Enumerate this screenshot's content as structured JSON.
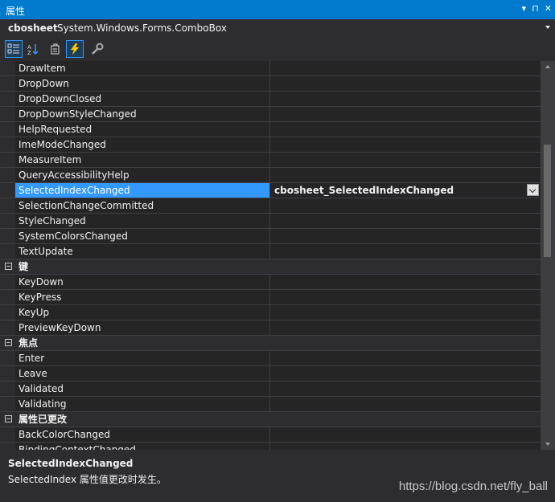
{
  "panel": {
    "title": "属性",
    "controls": [
      "▾",
      "⊓",
      "✕"
    ]
  },
  "object": {
    "name": "cbosheet",
    "type": "System.Windows.Forms.ComboBox"
  },
  "toolbar": {
    "buttons": [
      {
        "name": "categorized-icon",
        "active": true
      },
      {
        "name": "alphabetical-icon",
        "active": false
      },
      {
        "name": "properties-icon",
        "active": false
      },
      {
        "name": "events-icon",
        "active": true
      },
      {
        "name": "property-pages-icon",
        "active": false
      }
    ]
  },
  "rows": [
    {
      "type": "item",
      "name": "DrawItem",
      "value": ""
    },
    {
      "type": "item",
      "name": "DropDown",
      "value": ""
    },
    {
      "type": "item",
      "name": "DropDownClosed",
      "value": ""
    },
    {
      "type": "item",
      "name": "DropDownStyleChanged",
      "value": ""
    },
    {
      "type": "item",
      "name": "HelpRequested",
      "value": ""
    },
    {
      "type": "item",
      "name": "ImeModeChanged",
      "value": ""
    },
    {
      "type": "item",
      "name": "MeasureItem",
      "value": ""
    },
    {
      "type": "item",
      "name": "QueryAccessibilityHelp",
      "value": ""
    },
    {
      "type": "item",
      "name": "SelectedIndexChanged",
      "value": "cbosheet_SelectedIndexChanged",
      "selected": true
    },
    {
      "type": "item",
      "name": "SelectionChangeCommitted",
      "value": ""
    },
    {
      "type": "item",
      "name": "StyleChanged",
      "value": ""
    },
    {
      "type": "item",
      "name": "SystemColorsChanged",
      "value": ""
    },
    {
      "type": "item",
      "name": "TextUpdate",
      "value": ""
    },
    {
      "type": "category",
      "name": "键"
    },
    {
      "type": "item",
      "name": "KeyDown",
      "value": ""
    },
    {
      "type": "item",
      "name": "KeyPress",
      "value": ""
    },
    {
      "type": "item",
      "name": "KeyUp",
      "value": ""
    },
    {
      "type": "item",
      "name": "PreviewKeyDown",
      "value": ""
    },
    {
      "type": "category",
      "name": "焦点"
    },
    {
      "type": "item",
      "name": "Enter",
      "value": ""
    },
    {
      "type": "item",
      "name": "Leave",
      "value": ""
    },
    {
      "type": "item",
      "name": "Validated",
      "value": ""
    },
    {
      "type": "item",
      "name": "Validating",
      "value": ""
    },
    {
      "type": "category",
      "name": "属性已更改"
    },
    {
      "type": "item",
      "name": "BackColorChanged",
      "value": ""
    },
    {
      "type": "item",
      "name": "BindingContextChanged",
      "value": ""
    }
  ],
  "description": {
    "title": "SelectedIndexChanged",
    "text": "SelectedIndex 属性值更改时发生。"
  },
  "watermark": "https://blog.csdn.net/fly_ball",
  "colors": {
    "accent": "#007acc",
    "selection": "#3399ff",
    "background": "#252526"
  }
}
